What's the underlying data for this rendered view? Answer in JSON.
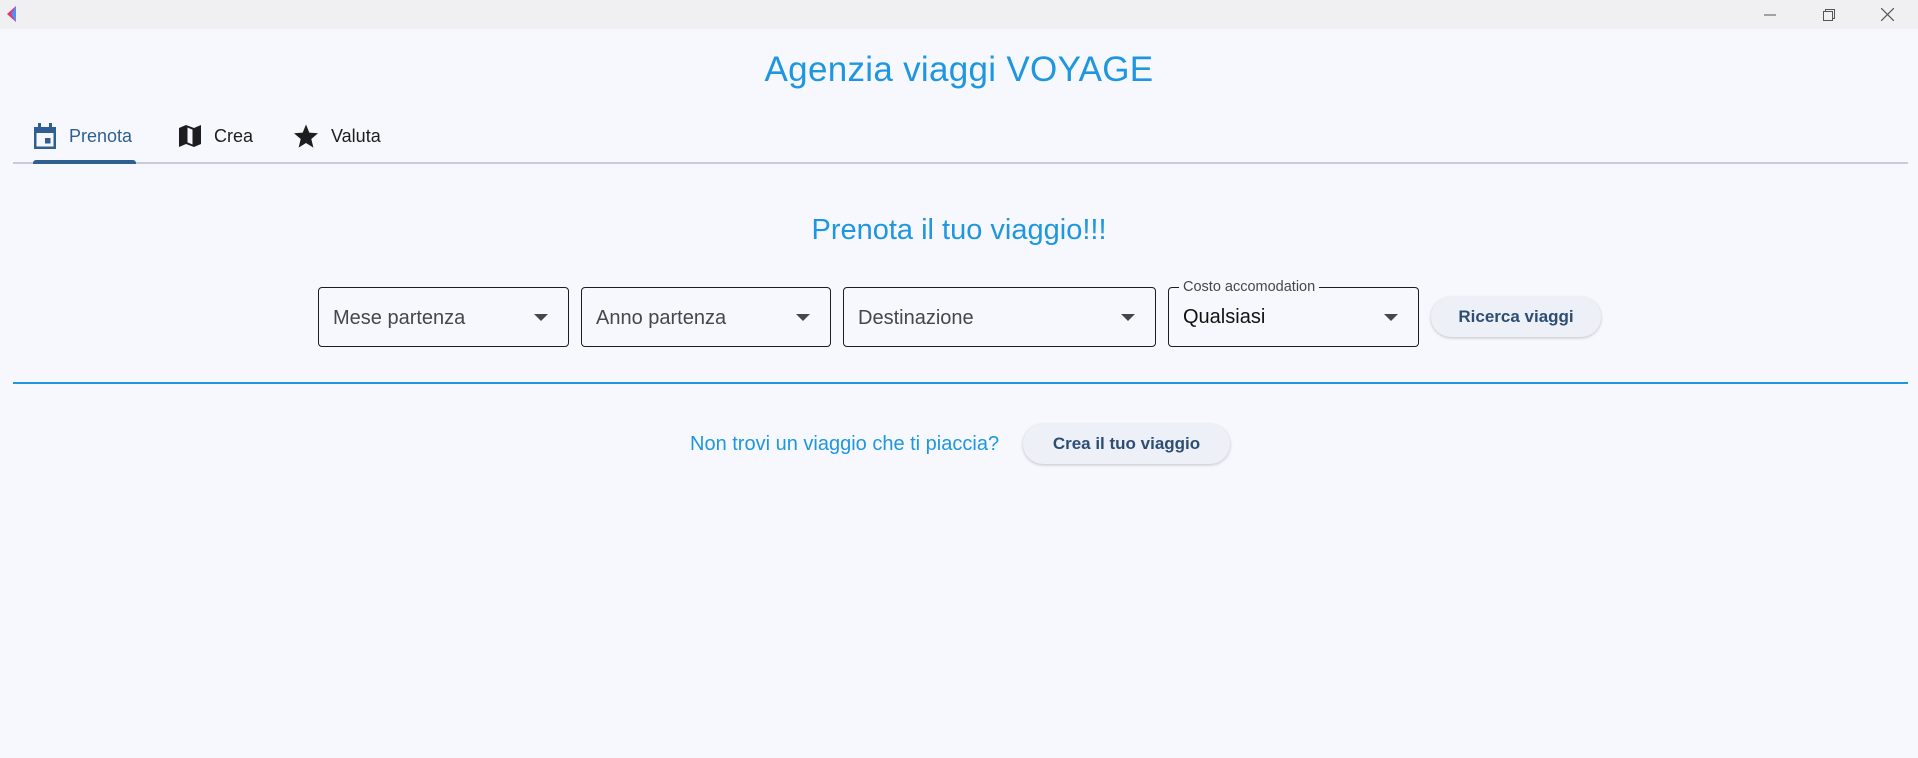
{
  "window": {
    "minimize_icon": "minimize-icon",
    "maximize_icon": "restore-icon",
    "close_icon": "close-icon"
  },
  "app": {
    "title": "Agenzia viaggi VOYAGE",
    "accent_color": "#1e96e0",
    "active_tab_color": "#2d5f92"
  },
  "tabs": [
    {
      "label": "Prenota",
      "icon": "calendar-icon",
      "active": true
    },
    {
      "label": "Crea",
      "icon": "map-icon",
      "active": false
    },
    {
      "label": "Valuta",
      "icon": "star-icon",
      "active": false
    }
  ],
  "booking": {
    "heading": "Prenota il tuo viaggio!!!",
    "filters": {
      "mese": {
        "placeholder": "Mese partenza"
      },
      "anno": {
        "placeholder": "Anno partenza"
      },
      "destinazione": {
        "placeholder": "Destinazione"
      },
      "costo": {
        "label": "Costo accomodation",
        "value": "Qualsiasi"
      }
    },
    "search_button": "Ricerca viaggi"
  },
  "create_prompt": {
    "text": "Non trovi un viaggio che ti piaccia?",
    "button": "Crea il tuo viaggio"
  }
}
